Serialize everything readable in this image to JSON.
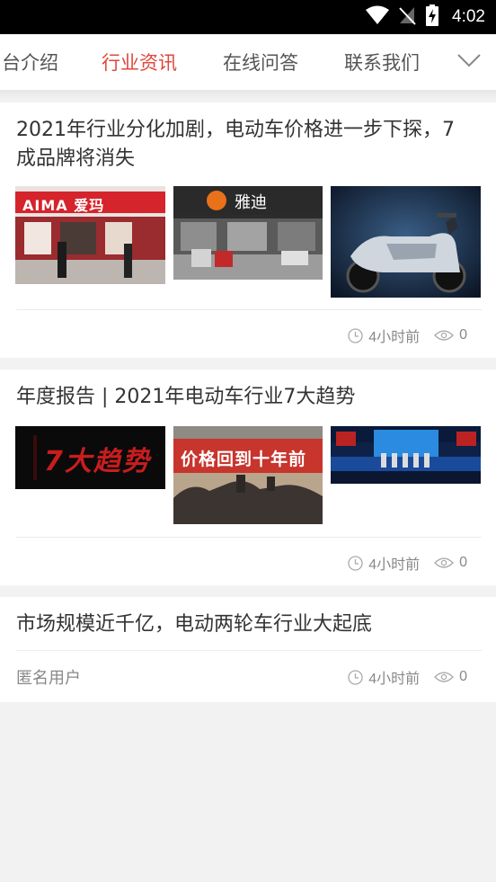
{
  "status_bar": {
    "time": "4:02"
  },
  "tabs": [
    {
      "label": "台介绍",
      "active": false
    },
    {
      "label": "行业资讯",
      "active": true
    },
    {
      "label": "在线问答",
      "active": false
    },
    {
      "label": "联系我们",
      "active": false
    }
  ],
  "colors": {
    "accent": "#e0473d",
    "text": "#333333",
    "muted": "#888888",
    "background": "#f2f2f2"
  },
  "articles": [
    {
      "title": "2021年行业分化加剧，电动车价格进一步下探，7成品牌将消失",
      "images": [
        {
          "sign_text": "AIMA 爱玛"
        },
        {
          "sign_text": "雅迪"
        },
        {
          "sign_text": ""
        }
      ],
      "time": "4小时前",
      "views": "0"
    },
    {
      "title": "年度报告 | 2021年电动车行业7大趋势",
      "images": [
        {
          "sign_text": "7大趋势"
        },
        {
          "sign_text": "价格回到十年前"
        },
        {
          "sign_text": ""
        }
      ],
      "time": "4小时前",
      "views": "0"
    },
    {
      "title": "市场规模近千亿，电动两轮车行业大起底",
      "author": "匿名用户",
      "time": "4小时前",
      "views": "0"
    }
  ]
}
